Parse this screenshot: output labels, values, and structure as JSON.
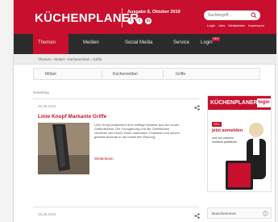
{
  "header": {
    "logo": "KÜCHENPLANER",
    "edition_date": "Ausgabe 8, Oktober 2019",
    "search_placeholder": "Suchbegriff...",
    "links": [
      "Login",
      "Jobs",
      "Mediadaten",
      "Impressum"
    ],
    "social": [
      "f",
      "t",
      "in"
    ]
  },
  "nav": {
    "items": [
      "Themen",
      "Medien",
      "Social Media",
      "Service",
      "Login"
    ],
    "badge": "NEU"
  },
  "breadcrumb": "Themen › Möbel › Küchenmöbel › Griffe",
  "subtabs": [
    "Möbel",
    "Küchenmöbel",
    "Griffe"
  ],
  "section_label": "Newsblog",
  "article": {
    "date": "26.08.2019",
    "title": "Linie Knopf Markante Griffe",
    "text": "Linie Knopf präsentiert eine kräftige Variante aus der neuen Griffkollektion. Die Formgebung und die Oberflächen verleihen der Küche einen markanten Charakter und setzen gezielte Akzente in der modernen Planung.",
    "read_more": "Weiterlesen"
  },
  "ad": {
    "brand": "KÜCHENPLANER",
    "login": "login",
    "badge": "NEU",
    "headline": "jetzt anmelden",
    "copy": "und von unseren Vorteilen profitieren"
  },
  "article2": {
    "date": "28.08.2019"
  },
  "widget": {
    "title": "Branchennews"
  },
  "colors": {
    "brand": "#c8102e",
    "nav": "#2b2b2b"
  }
}
